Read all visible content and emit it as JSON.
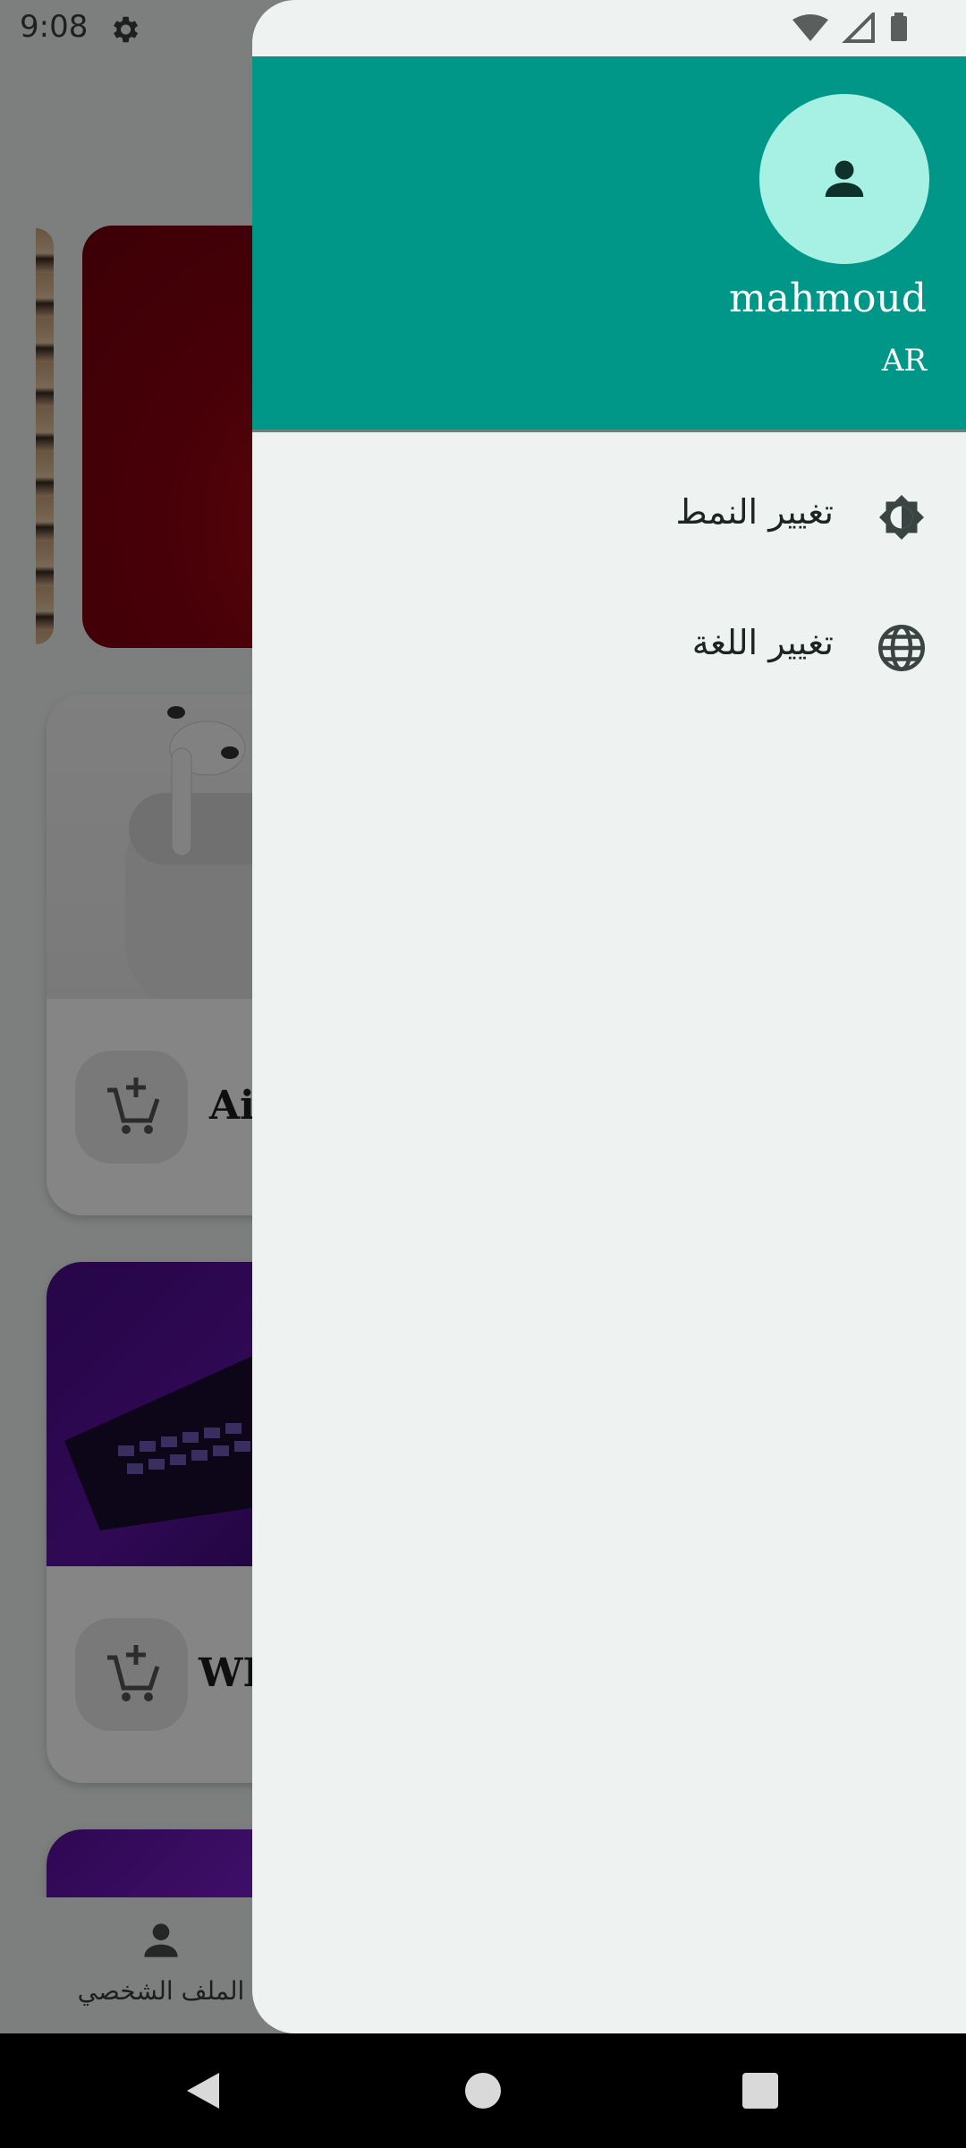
{
  "status_bar": {
    "time": "9:08"
  },
  "background_app": {
    "products": [
      {
        "title": "Ai"
      },
      {
        "title": "WH"
      }
    ],
    "bottom_nav": {
      "profile_label": "الملف الشخصي"
    }
  },
  "drawer": {
    "user": {
      "name": "mahmoud",
      "language": "AR"
    },
    "items": [
      {
        "label": "تغيير النمط",
        "icon": "brightness-icon"
      },
      {
        "label": "تغيير اللغة",
        "icon": "globe-icon"
      }
    ]
  },
  "colors": {
    "drawer_header": "#009688",
    "avatar_bg": "#a6f1e3",
    "scrim": "rgba(0,0,0,0.48)"
  }
}
